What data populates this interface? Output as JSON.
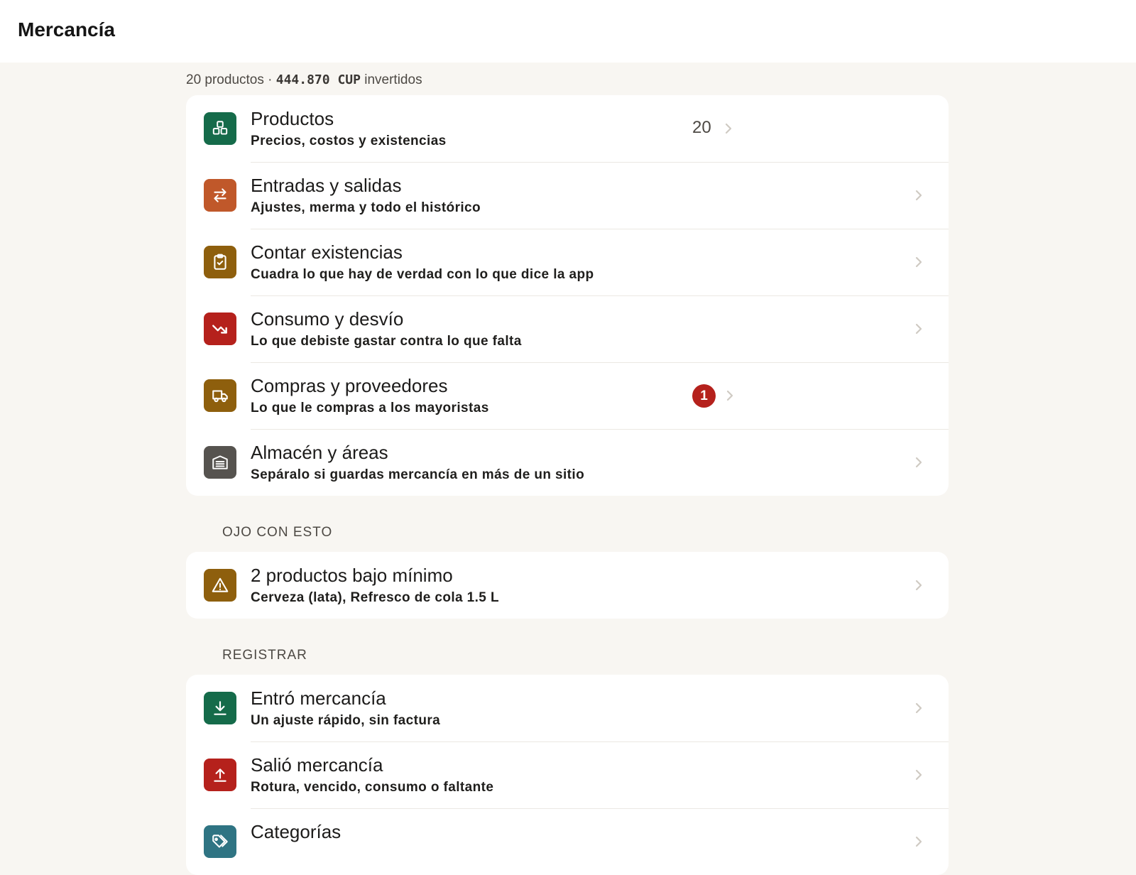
{
  "header": {
    "title": "Mercancía"
  },
  "summary": {
    "products": "20 productos ·",
    "amount": "444.870 CUP",
    "suffix": "invertidos"
  },
  "main_menu": [
    {
      "title": "Productos",
      "subtitle": "Precios, costos y existencias",
      "count": "20",
      "icon": "boxes-icon",
      "color": "#156b4a"
    },
    {
      "title": "Entradas y salidas",
      "subtitle": "Ajustes, merma y todo el histórico",
      "icon": "arrows-swap-icon",
      "color": "#c0582a"
    },
    {
      "title": "Contar existencias",
      "subtitle": "Cuadra lo que hay de verdad con lo que dice la app",
      "icon": "clipboard-check-icon",
      "color": "#8e5f0d"
    },
    {
      "title": "Consumo y desvío",
      "subtitle": "Lo que debiste gastar contra lo que falta",
      "icon": "trending-down-icon",
      "color": "#b5211c"
    },
    {
      "title": "Compras y proveedores",
      "subtitle": "Lo que le compras a los mayoristas",
      "badge": "1",
      "icon": "truck-icon",
      "color": "#8e5f0d"
    },
    {
      "title": "Almacén y áreas",
      "subtitle": "Sepáralo si guardas mercancía en más de un sitio",
      "icon": "warehouse-icon",
      "color": "#56534f"
    }
  ],
  "alerts": {
    "label": "OJO CON ESTO",
    "items": [
      {
        "title": "2 productos bajo mínimo",
        "subtitle": "Cerveza (lata), Refresco de cola 1.5 L",
        "icon": "warning-icon",
        "color": "#8e5f0d"
      }
    ]
  },
  "register": {
    "label": "REGISTRAR",
    "items": [
      {
        "title": "Entró mercancía",
        "subtitle": "Un ajuste rápido, sin factura",
        "icon": "download-icon",
        "color": "#156b4a"
      },
      {
        "title": "Salió mercancía",
        "subtitle": "Rotura, vencido, consumo o faltante",
        "icon": "upload-icon",
        "color": "#b5211c"
      },
      {
        "title": "Categorías",
        "icon": "tags-icon",
        "color": "#2f7483"
      }
    ]
  }
}
